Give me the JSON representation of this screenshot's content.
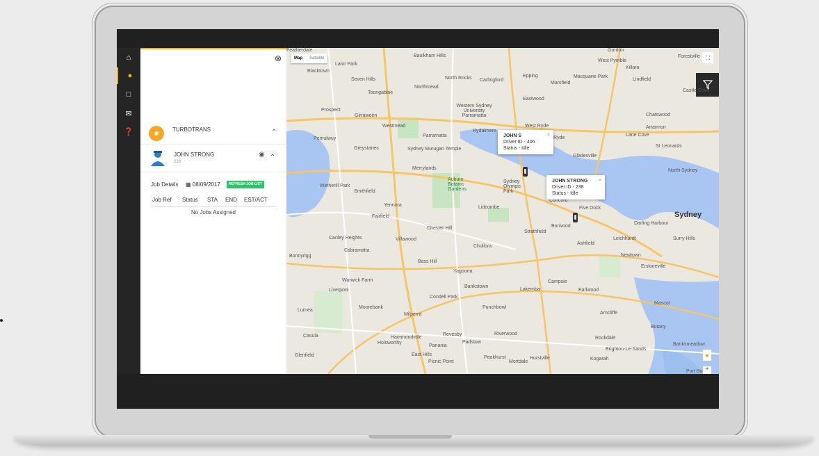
{
  "rail": {
    "icons": [
      "home-icon",
      "user-icon",
      "clipboard-icon",
      "mail-icon",
      "help-icon"
    ],
    "active_index": 1
  },
  "company": {
    "name": "TURBOTRANS"
  },
  "driver": {
    "name": "JOHN STRONG",
    "id": "238"
  },
  "jobs": {
    "label": "Job Details",
    "date": "08/09/2017",
    "refresh_label": "REFRESH JOB LIST",
    "columns": [
      "Job Ref",
      "Status",
      "STA",
      "END",
      "EST/ACT"
    ],
    "empty_text": "No Jobs Assigned"
  },
  "map": {
    "map_tab": "Map",
    "satellite_tab": "Satellite",
    "popups": [
      {
        "title": "JOHN S",
        "line1": "Driver ID - 406",
        "line2": "Status - Idle"
      },
      {
        "title": "JOHN STRONG",
        "line1": "Driver ID - 238",
        "line2": "Status - Idle"
      }
    ],
    "places": [
      "Featherdale",
      "Baulkham Hills",
      "Lalor Park",
      "Blacktown",
      "Seven Hills",
      "North Rocks",
      "Carlingford",
      "Epping",
      "Marsfield",
      "Macquarie Park",
      "Killara",
      "Lindfield",
      "Northmead",
      "Toongabbie",
      "Eastwood",
      "Western Sydney University Parramatta",
      "Prospect",
      "Girraween",
      "Westmead",
      "Parramatta",
      "Rydalmere",
      "West Ryde",
      "Ryde",
      "Chatswood",
      "Artarmon",
      "Lane Cove",
      "Pemulwuy",
      "Greystanes",
      "Sydney Murugan Temple",
      "Gladesville",
      "St Leonards",
      "North Sydney",
      "Merrylands",
      "Auburn Botanic Gardens",
      "Sydney Olympic Park",
      "Concord",
      "Five Dock",
      "Sydney",
      "Darling Harbour",
      "Wetherill Park",
      "Smithfield",
      "Yennora",
      "Fairfield",
      "Lidcombe",
      "Burwood",
      "Ashfield",
      "Leichhardt",
      "Surry Hills",
      "Chester Hill",
      "Strathfield",
      "Villawood",
      "Canley Heights",
      "Cabramatta",
      "Chullora",
      "Newtown",
      "Bass Hill",
      "Yagoona",
      "Erskineville",
      "Warwick Farm",
      "Liverpool",
      "Bankstown",
      "Lakemba",
      "Campsie",
      "Earlwood",
      "Condell Park",
      "Moorebank",
      "Punchbowl",
      "Milperra",
      "Arncliffe",
      "Mascot",
      "Casula",
      "Revesby",
      "Riverwood",
      "Hammondville",
      "Holsworthy",
      "Padstow",
      "Panania",
      "East Hills",
      "Peakhurst",
      "Hurstville",
      "Mortdale",
      "Picnic Point",
      "Kogarah",
      "Rockdale",
      "Botany",
      "Banksmeadow",
      "Brighton-Le-Sands",
      "Glenfield",
      "Lurnea",
      "Bonnyrigg",
      "Gordon",
      "West Pymble",
      "Castle Cove",
      "Forestville",
      "Port Bo"
    ]
  }
}
